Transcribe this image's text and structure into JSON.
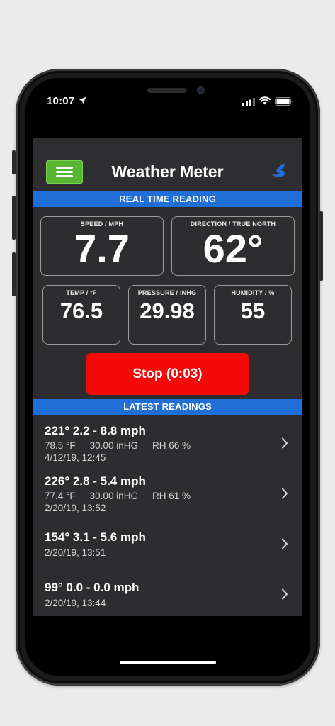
{
  "status_bar": {
    "time": "10:07",
    "icons": [
      "location-arrow-icon",
      "cellular-signal-icon",
      "wifi-icon",
      "battery-icon"
    ]
  },
  "header": {
    "title": "Weather Meter",
    "menu_icon": "hamburger-menu-icon",
    "logo_icon": "brand-swoosh-icon"
  },
  "realtime": {
    "heading": "REAL TIME READING",
    "speed": {
      "label": "SPEED / MPH",
      "value": "7.7"
    },
    "direction": {
      "label": "DIRECTION / TRUE NORTH",
      "value": "62°"
    },
    "temp": {
      "label": "TEMP / °F",
      "value": "76.5"
    },
    "pressure": {
      "label": "PRESSURE / INHG",
      "value": "29.98"
    },
    "humidity": {
      "label": "HUMIDITY / %",
      "value": "55"
    }
  },
  "stop_button": {
    "label": "Stop (0:03)"
  },
  "latest": {
    "heading": "LATEST READINGS",
    "readings": [
      {
        "title": "221° 2.2 - 8.8 mph",
        "temp": "78.5 °F",
        "pressure": "30.00 inHG",
        "humidity": "RH 66 %",
        "date": "4/12/19, 12:45"
      },
      {
        "title": "226° 2.8 - 5.4 mph",
        "temp": "77.4 °F",
        "pressure": "30.00 inHG",
        "humidity": "RH 61 %",
        "date": "2/20/19, 13:52"
      },
      {
        "title": "154° 3.1 - 5.6 mph",
        "date": "2/20/19, 13:51"
      },
      {
        "title": "99° 0.0 - 0.0 mph",
        "date": "2/20/19, 13:44"
      }
    ]
  },
  "colors": {
    "accent_blue": "#1f6fd6",
    "stop_red": "#f50a0a",
    "menu_green": "#58b531",
    "panel_bg": "#2d2d2f"
  }
}
